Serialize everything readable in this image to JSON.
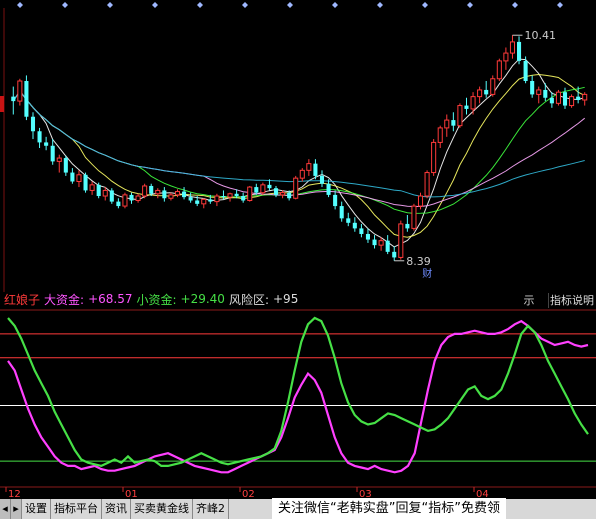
{
  "chart_data": [
    {
      "type": "candlestick",
      "title": "",
      "price_markers": {
        "high_label": "10.41",
        "low_label": "8.39",
        "low_tag": "财"
      },
      "ma_colors": [
        "#ffffff",
        "#ffff66",
        "#40ff40",
        "#ffaaff",
        "#33bbdd"
      ],
      "up_color": "#ff3a3a",
      "down_color": "#54ffff",
      "candles": [
        [
          9.86,
          9.95,
          9.7,
          9.82
        ],
        [
          9.82,
          10.02,
          9.78,
          10.0
        ],
        [
          10.0,
          10.05,
          9.65,
          9.68
        ],
        [
          9.68,
          9.72,
          9.48,
          9.55
        ],
        [
          9.55,
          9.58,
          9.4,
          9.45
        ],
        [
          9.45,
          9.5,
          9.38,
          9.42
        ],
        [
          9.42,
          9.48,
          9.25,
          9.28
        ],
        [
          9.28,
          9.34,
          9.18,
          9.31
        ],
        [
          9.31,
          9.33,
          9.15,
          9.18
        ],
        [
          9.18,
          9.22,
          9.08,
          9.1
        ],
        [
          9.1,
          9.2,
          9.05,
          9.16
        ],
        [
          9.16,
          9.18,
          9.0,
          9.02
        ],
        [
          9.02,
          9.1,
          8.98,
          9.07
        ],
        [
          9.07,
          9.09,
          8.95,
          8.97
        ],
        [
          8.97,
          9.05,
          8.93,
          9.02
        ],
        [
          9.02,
          9.04,
          8.9,
          8.92
        ],
        [
          8.92,
          8.95,
          8.86,
          8.88
        ],
        [
          8.88,
          9.0,
          8.86,
          8.98
        ],
        [
          8.98,
          9.0,
          8.9,
          8.93
        ],
        [
          8.93,
          8.99,
          8.91,
          8.97
        ],
        [
          8.97,
          9.08,
          8.95,
          9.06
        ],
        [
          9.06,
          9.08,
          8.97,
          8.99
        ],
        [
          8.99,
          9.04,
          8.95,
          9.02
        ],
        [
          9.02,
          9.05,
          8.92,
          8.95
        ],
        [
          8.95,
          9.0,
          8.93,
          8.98
        ],
        [
          8.98,
          9.03,
          8.96,
          9.01
        ],
        [
          9.01,
          9.05,
          8.94,
          8.96
        ],
        [
          8.96,
          9.0,
          8.91,
          8.93
        ],
        [
          8.93,
          8.97,
          8.88,
          8.9
        ],
        [
          8.9,
          8.95,
          8.86,
          8.94
        ],
        [
          8.94,
          8.98,
          8.9,
          8.92
        ],
        [
          8.92,
          8.99,
          8.88,
          8.97
        ],
        [
          8.97,
          9.02,
          8.94,
          8.96
        ],
        [
          8.96,
          9.0,
          8.92,
          8.99
        ],
        [
          8.99,
          9.03,
          8.95,
          8.97
        ],
        [
          8.97,
          9.0,
          8.91,
          8.93
        ],
        [
          8.93,
          9.06,
          8.92,
          9.05
        ],
        [
          9.05,
          9.08,
          8.98,
          9.0
        ],
        [
          9.0,
          9.09,
          8.98,
          9.07
        ],
        [
          9.07,
          9.12,
          9.02,
          9.04
        ],
        [
          9.04,
          9.06,
          8.96,
          8.98
        ],
        [
          8.98,
          9.02,
          8.95,
          9.0
        ],
        [
          9.0,
          9.02,
          8.93,
          8.95
        ],
        [
          8.95,
          9.15,
          8.94,
          9.13
        ],
        [
          9.13,
          9.22,
          9.1,
          9.2
        ],
        [
          9.2,
          9.3,
          9.15,
          9.26
        ],
        [
          9.26,
          9.3,
          9.12,
          9.15
        ],
        [
          9.15,
          9.2,
          9.05,
          9.08
        ],
        [
          9.08,
          9.12,
          8.96,
          8.98
        ],
        [
          8.98,
          9.02,
          8.85,
          8.88
        ],
        [
          8.88,
          8.92,
          8.74,
          8.77
        ],
        [
          8.77,
          8.82,
          8.7,
          8.73
        ],
        [
          8.73,
          8.78,
          8.65,
          8.68
        ],
        [
          8.68,
          8.72,
          8.6,
          8.63
        ],
        [
          8.63,
          8.68,
          8.55,
          8.58
        ],
        [
          8.58,
          8.62,
          8.5,
          8.53
        ],
        [
          8.53,
          8.6,
          8.48,
          8.57
        ],
        [
          8.57,
          8.62,
          8.45,
          8.47
        ],
        [
          8.47,
          8.52,
          8.39,
          8.42
        ],
        [
          8.42,
          8.75,
          8.4,
          8.72
        ],
        [
          8.72,
          8.8,
          8.65,
          8.68
        ],
        [
          8.68,
          8.9,
          8.66,
          8.88
        ],
        [
          8.88,
          9.0,
          8.85,
          8.97
        ],
        [
          8.97,
          9.2,
          8.95,
          9.18
        ],
        [
          9.18,
          9.48,
          9.15,
          9.45
        ],
        [
          9.45,
          9.6,
          9.4,
          9.58
        ],
        [
          9.58,
          9.7,
          9.5,
          9.65
        ],
        [
          9.65,
          9.72,
          9.55,
          9.6
        ],
        [
          9.6,
          9.8,
          9.58,
          9.78
        ],
        [
          9.78,
          9.85,
          9.7,
          9.75
        ],
        [
          9.75,
          9.9,
          9.7,
          9.86
        ],
        [
          9.86,
          9.95,
          9.8,
          9.92
        ],
        [
          9.92,
          10.0,
          9.85,
          9.88
        ],
        [
          9.88,
          10.05,
          9.86,
          10.02
        ],
        [
          10.02,
          10.2,
          10.0,
          10.18
        ],
        [
          10.18,
          10.3,
          10.1,
          10.25
        ],
        [
          10.25,
          10.41,
          10.2,
          10.35
        ],
        [
          10.35,
          10.4,
          10.15,
          10.18
        ],
        [
          10.18,
          10.22,
          9.98,
          10.0
        ],
        [
          10.0,
          10.05,
          9.85,
          9.88
        ],
        [
          9.88,
          9.95,
          9.8,
          9.92
        ],
        [
          9.92,
          9.98,
          9.82,
          9.85
        ],
        [
          9.85,
          9.9,
          9.76,
          9.8
        ],
        [
          9.8,
          9.92,
          9.78,
          9.9
        ],
        [
          9.9,
          9.94,
          9.75,
          9.78
        ],
        [
          9.78,
          9.88,
          9.76,
          9.86
        ],
        [
          9.86,
          9.95,
          9.8,
          9.83
        ],
        [
          9.83,
          9.9,
          9.78,
          9.88
        ]
      ]
    },
    {
      "type": "line",
      "title": "红娘子",
      "header": [
        {
          "label": "红娘子",
          "value": ""
        },
        {
          "label": "大资金:",
          "value": "+68.57"
        },
        {
          "label": "小资金:",
          "value": "+29.40"
        },
        {
          "label": "风险区:",
          "value": "+95"
        }
      ],
      "x_ticks": [
        "12",
        "01",
        "02",
        "03",
        "04"
      ],
      "reference_levels": {
        "top": 95,
        "upper": 80,
        "middle": 50,
        "lower": 15
      },
      "ylim": [
        0,
        110
      ],
      "series": [
        {
          "name": "大资金",
          "color": "#ff40ff",
          "values": [
            78,
            72,
            60,
            48,
            38,
            30,
            24,
            18,
            14,
            12,
            12,
            10,
            11,
            12,
            10,
            9,
            9,
            10,
            11,
            12,
            14,
            16,
            18,
            19,
            20,
            18,
            16,
            14,
            12,
            11,
            10,
            9,
            8,
            8,
            10,
            12,
            14,
            16,
            18,
            20,
            22,
            30,
            42,
            55,
            63,
            70,
            66,
            58,
            44,
            30,
            20,
            14,
            12,
            11,
            10,
            12,
            10,
            9,
            8,
            9,
            12,
            20,
            40,
            60,
            78,
            88,
            93,
            95,
            95,
            96,
            97,
            96,
            95,
            95,
            96,
            98,
            101,
            103,
            100,
            96,
            92,
            90,
            88,
            89,
            90,
            88,
            87,
            88
          ]
        },
        {
          "name": "小资金",
          "color": "#46e046",
          "values": [
            105,
            100,
            92,
            82,
            72,
            64,
            56,
            46,
            38,
            30,
            22,
            16,
            14,
            13,
            12,
            14,
            16,
            14,
            18,
            14,
            15,
            16,
            15,
            12,
            12,
            13,
            14,
            16,
            18,
            20,
            18,
            16,
            14,
            13,
            14,
            15,
            16,
            17,
            18,
            20,
            23,
            34,
            52,
            72,
            90,
            101,
            105,
            103,
            94,
            80,
            64,
            52,
            44,
            40,
            38,
            39,
            42,
            45,
            44,
            42,
            40,
            38,
            36,
            34,
            35,
            38,
            42,
            48,
            54,
            60,
            62,
            56,
            54,
            56,
            60,
            70,
            82,
            95,
            100,
            96,
            88,
            78,
            70,
            62,
            54,
            45,
            38,
            32
          ]
        }
      ]
    }
  ],
  "footer": {
    "tabs": [
      "设置",
      "指标平台",
      "资讯",
      "买卖黄金线",
      "齐峰2"
    ],
    "banner": "关注微信“老韩实盘”回复“指标”免费领"
  },
  "indicator_buttons": {
    "small": "示",
    "help": "指标说明"
  }
}
